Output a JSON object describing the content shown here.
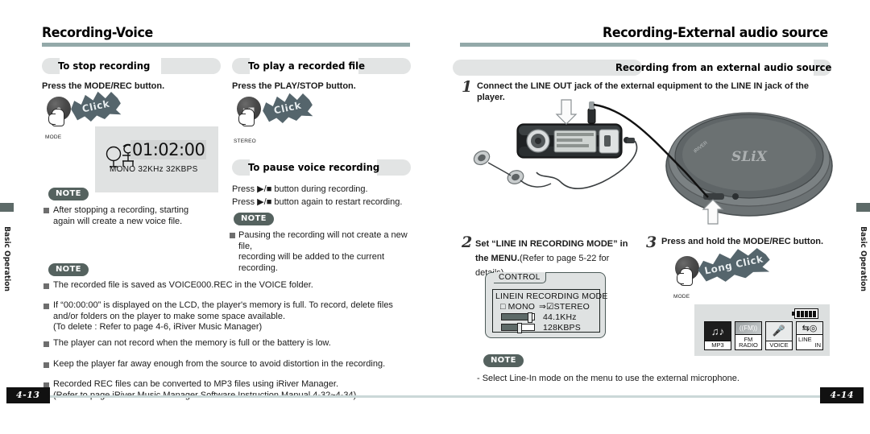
{
  "spread": {
    "left_page": {
      "title": "Recording-Voice",
      "page_number": "4-13",
      "side_tab": "Basic Operation",
      "sections": [
        {
          "heading": "To stop recording",
          "instruction": "Press the MODE/REC button.",
          "button_caption": "MODE",
          "burst_label": "Click",
          "lcd": {
            "time": "01:02:00",
            "status": "MONO  32KHz  32KBPS"
          },
          "note_label": "NOTE",
          "note_items": [
            "After stopping a recording, starting\nagain will create a new voice file."
          ]
        },
        {
          "heading": "To play a recorded file",
          "instruction": "Press the PLAY/STOP button.",
          "button_caption": "STEREO",
          "burst_label": "Click"
        },
        {
          "heading": "To pause voice recording",
          "lines": [
            "Press ▶/■ button during recording.",
            "Press ▶/■ button again to restart recording."
          ],
          "note_label": "NOTE",
          "note_items": [
            "Pausing the recording will not create a new file,\nrecording will be added to the current recording."
          ]
        }
      ],
      "bottom_note": {
        "label": "NOTE",
        "items": [
          "The recorded file is saved as VOICE000.REC in the VOICE folder.",
          "If “00:00:00” is displayed on the LCD, the player's memory is full. To record, delete files\nand/or folders on the player to make some space available.\n(To delete : Refer to page 4-6, iRiver Music Manager)",
          "The player can not record when the memory is full or the battery is low.",
          "Keep the player far away enough from the source to avoid distortion in the recording.",
          "Recorded REC files can be converted to MP3 files using iRiver Manager.\n(Refer to page iRiver Music Manager Software Instruction Manual 4-32~4-34)"
        ]
      }
    },
    "right_page": {
      "title": "Recording-External audio source",
      "page_number": "4-14",
      "side_tab": "Basic Operation",
      "heading": "Recording from an external audio source",
      "steps": [
        {
          "number": "1",
          "text": "Connect the LINE OUT jack of the external equipment to the LINE IN jack of the player."
        },
        {
          "number": "2",
          "text_bold": "Set “LINE IN RECORDING MODE” in\nthe MENU.",
          "text_normal": "(Refer to page 5-22 for\ndetails)"
        },
        {
          "number": "3",
          "text": "Press and hold the MODE/REC button.",
          "button_caption": "MODE",
          "burst_label": "Long Click"
        }
      ],
      "control_menu": {
        "tab_label": "CONTROL",
        "title": "LINEIN RECORDING MODE",
        "option_mono": "MONO",
        "option_stereo": "STEREO",
        "mono_checked": false,
        "stereo_checked": true,
        "arrow": "⇒",
        "sample_rate": "44.1KHz",
        "bitrate": "128KBPS"
      },
      "mode_screen": {
        "cells": [
          {
            "label": "MP3",
            "label2": "",
            "selected": true,
            "icon": "music-note-icon"
          },
          {
            "label": "FM",
            "label2": "RADIO",
            "selected": false,
            "icon": "fm-radio-icon"
          },
          {
            "label": "VOICE",
            "label2": "",
            "selected": false,
            "icon": "microphone-icon"
          },
          {
            "label": "LINE",
            "label2": "IN",
            "selected": false,
            "icon": "line-in-icon"
          }
        ],
        "battery_bars": 5
      },
      "note": {
        "label": "NOTE",
        "items": [
          "- Select Line-In mode on the menu to use the external microphone."
        ]
      }
    }
  },
  "colors": {
    "rule": "#93a9a9",
    "section_bar": "#e2e4e4",
    "note_pill": "#55625f",
    "side_tab": "#5d6a68",
    "lcd_bg": "#e0e2e2"
  }
}
